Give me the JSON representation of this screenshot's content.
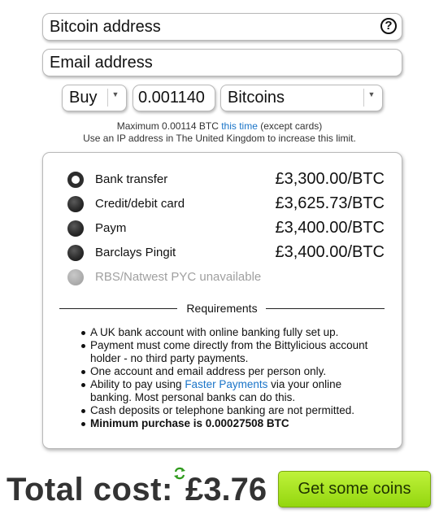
{
  "form": {
    "bitcoin_address_placeholder": "Bitcoin address",
    "email_placeholder": "Email address",
    "action_select": "Buy",
    "amount_value": "0.001140",
    "unit_select": "Bitcoins",
    "help_glyph": "?"
  },
  "limits": {
    "line1_prefix": "Maximum 0.00114 BTC ",
    "line1_link": "this time",
    "line1_suffix": " (except cards)",
    "line2": "Use an IP address in The United Kingdom to increase this limit."
  },
  "payment_methods": [
    {
      "label": "Bank transfer",
      "price": "£3,300.00/BTC",
      "state": "selected"
    },
    {
      "label": "Credit/debit card",
      "price": "£3,625.73/BTC",
      "state": "normal"
    },
    {
      "label": "Paym",
      "price": "£3,400.00/BTC",
      "state": "normal"
    },
    {
      "label": "Barclays Pingit",
      "price": "£3,400.00/BTC",
      "state": "normal"
    },
    {
      "label": "RBS/Natwest PYC unavailable",
      "price": "",
      "state": "disabled"
    }
  ],
  "requirements": {
    "title": "Requirements",
    "item1": "A UK bank account with online banking fully set up.",
    "item2": "Payment must come directly from the Bittylicious account holder - no third party payments.",
    "item3": "One account and email address per person only.",
    "item4_prefix": "Ability to pay using ",
    "item4_link": "Faster Payments",
    "item4_suffix": " via your online banking. Most personal banks can do this.",
    "item5": "Cash deposits or telephone banking are not permitted.",
    "item6": "Minimum purchase is 0.00027508 BTC"
  },
  "footer": {
    "total_label": "Total cost:",
    "total_value": "£3.76",
    "submit_label": "Get some coins"
  },
  "colors": {
    "link": "#1a74c8",
    "button_green": "#a7e322",
    "refresh_green": "#2f9a1c"
  },
  "icons": {
    "help": "question-circle",
    "refresh": "refresh-arrows"
  }
}
